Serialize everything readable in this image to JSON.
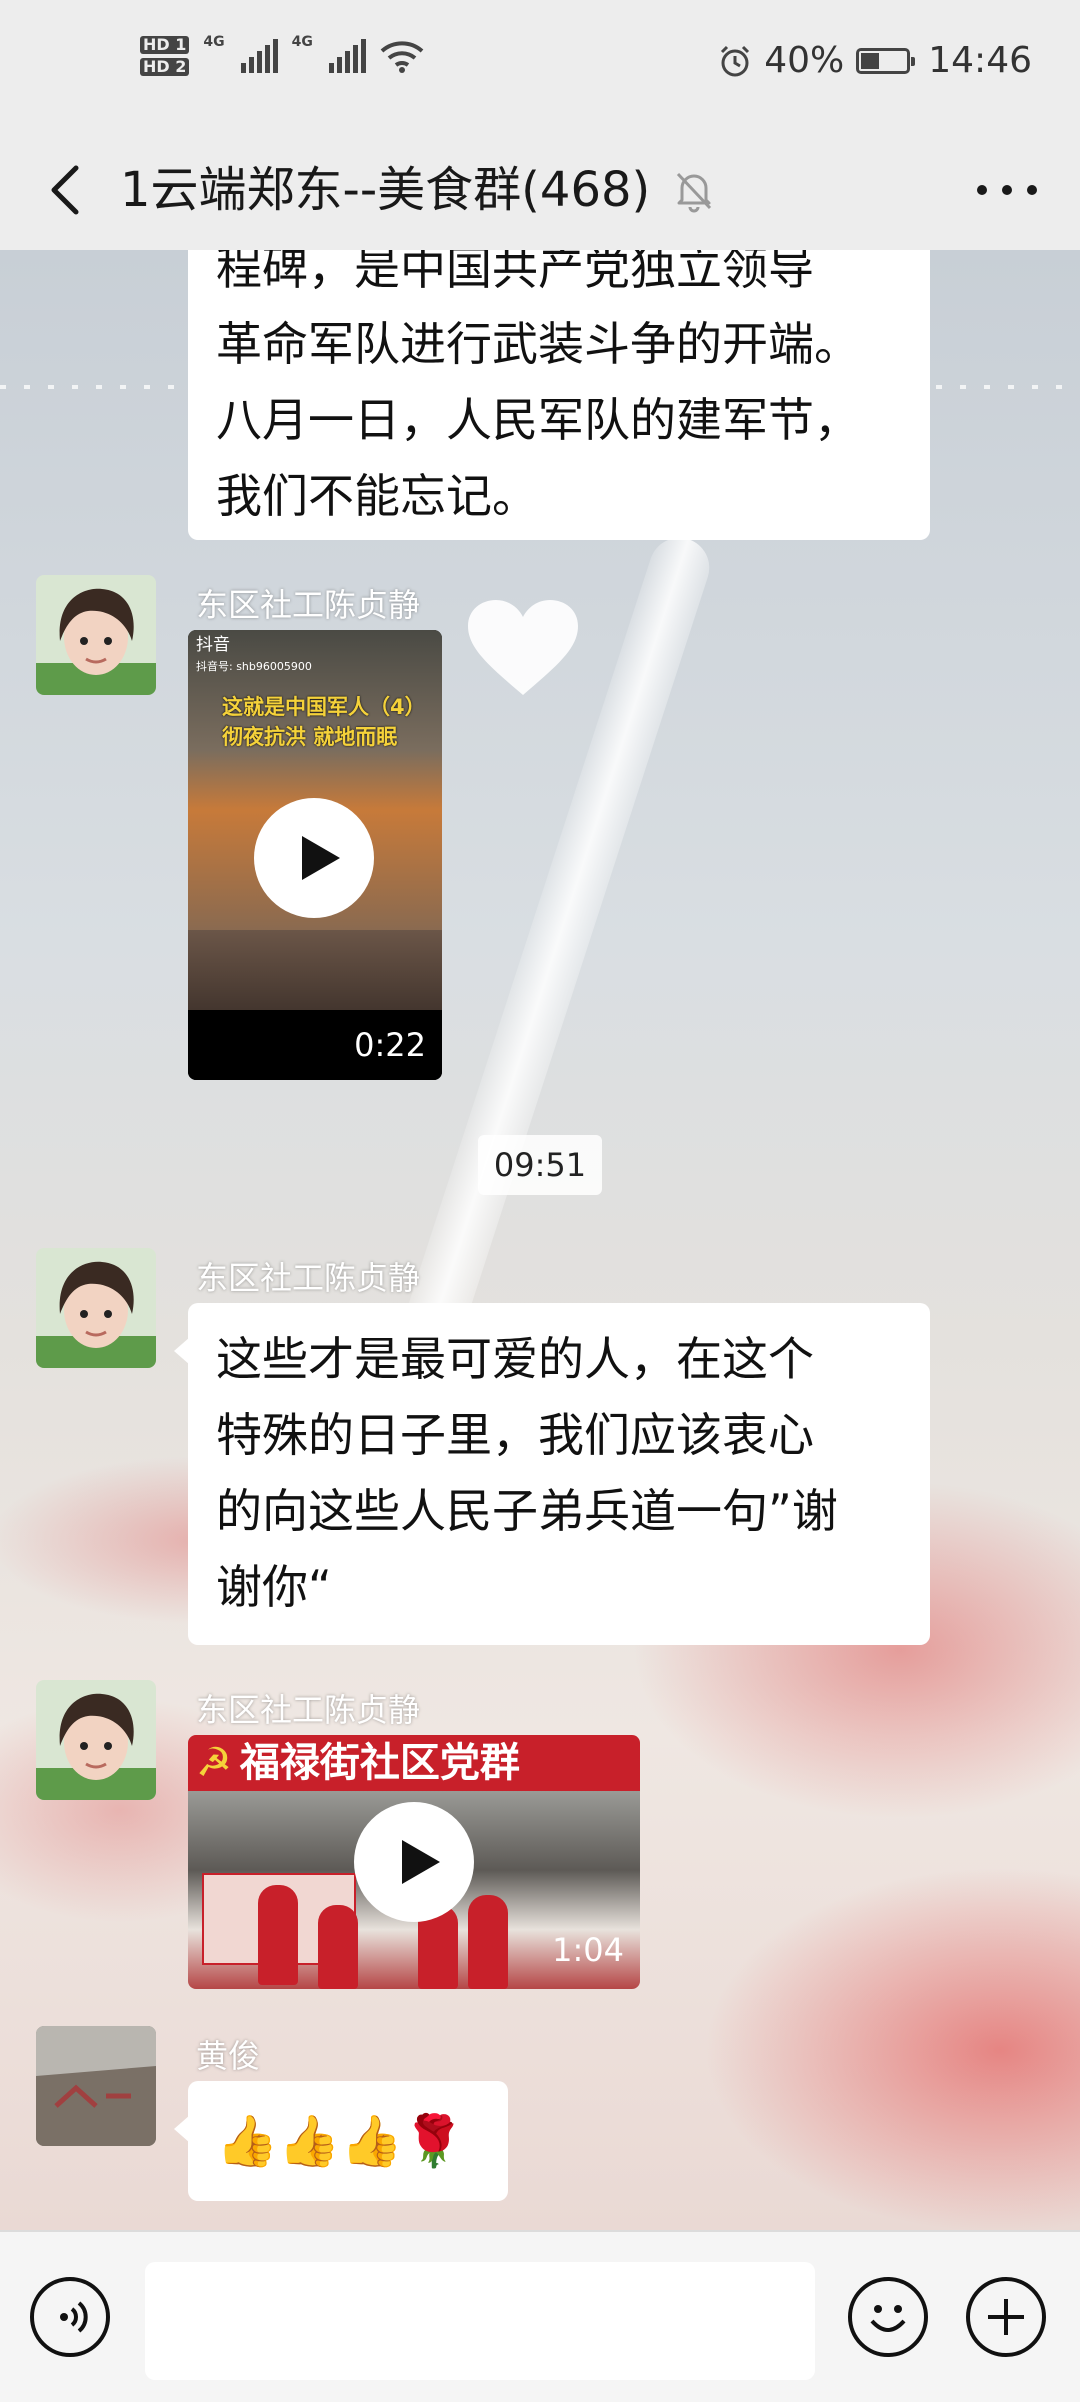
{
  "status_bar": {
    "sim1": "HD 1",
    "sim2": "HD 2",
    "network_1": "4G",
    "network_2": "4G",
    "battery": "40%",
    "battery_level": 0.4,
    "time": "14:46"
  },
  "header": {
    "title": "1云端郑东--美食群(468)",
    "muted": true
  },
  "messages": [
    {
      "type": "text",
      "lines": [
        "程碑，是中国共产党独立领导",
        "革命军队进行武装斗争的开端。",
        "八月一日，人民军队的建军节，",
        "我们不能忘记。"
      ]
    },
    {
      "type": "video",
      "sender": "东区社工陈贞静",
      "watermark": "抖音",
      "account": "抖音号: shb96005900",
      "caption_line1": "这就是中国军人（4）",
      "caption_line2": "彻夜抗洪 就地而眠",
      "duration": "0:22"
    },
    {
      "type": "timestamp",
      "text": "09:51"
    },
    {
      "type": "text",
      "sender": "东区社工陈贞静",
      "lines": [
        "这些才是最可爱的人，在这个",
        "特殊的日子里，我们应该衷心",
        "的向这些人民子弟兵道一句”谢",
        "谢你“"
      ]
    },
    {
      "type": "video",
      "sender": "东区社工陈贞静",
      "banner": "福禄街社区党群",
      "duration": "1:04"
    },
    {
      "type": "emoji",
      "sender": "黄俊",
      "emoji": "👍👍👍🌹"
    }
  ],
  "colors": {
    "bar_bg": "#ededed",
    "bubble_bg": "#ffffff",
    "banner_red": "#c8202a"
  },
  "input_bar": {
    "left_icon": "voice-icon",
    "emoji_icon": "emoji-icon",
    "plus_icon": "plus-icon"
  }
}
